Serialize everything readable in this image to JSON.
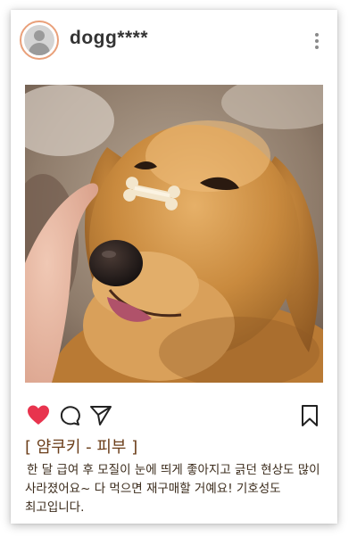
{
  "post": {
    "username": "dogg****",
    "caption_title": "[ 얌쿠키 - 피부 ]",
    "caption_body": "한 달 급여 후 모질이 눈에 띄게 좋아지고 긁던 현상도 많이 사라졌어요~ 다 먹으면 재구매할 거예요! 기호성도 최고입니다."
  },
  "icons": {
    "avatar": "user-avatar-icon",
    "more": "more-vertical-icon",
    "like": "heart-icon",
    "comment": "comment-icon",
    "share": "send-icon",
    "save": "bookmark-icon"
  },
  "colors": {
    "avatar_ring": "#e9a07a",
    "like": "#e8344e",
    "caption_title": "#6b3e1a",
    "caption_body": "#3a2a1a"
  },
  "state": {
    "liked": true
  }
}
